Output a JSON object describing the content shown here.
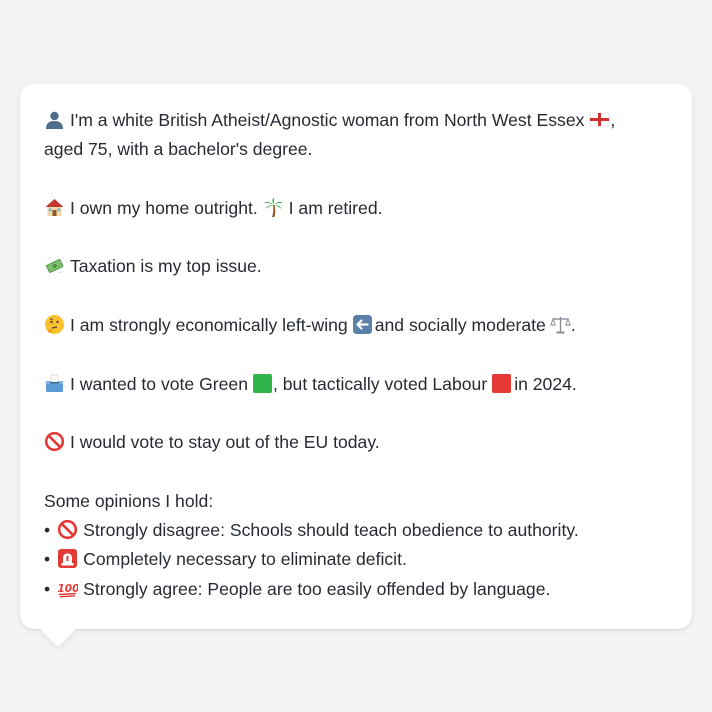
{
  "persona": {
    "intro_line1": "I'm a white British Atheist/Agnostic woman from North West Essex",
    "intro_line1_end": ",",
    "intro_line2": "aged 75, with a bachelor's degree.",
    "home": "I own my home outright.",
    "retired": "I am retired.",
    "top_issue": "Taxation is my top issue.",
    "econ_prefix": "I am strongly economically left-wing",
    "econ_mid": "and socially moderate",
    "econ_end": ".",
    "vote_prefix": "I wanted to vote Green",
    "vote_mid": ", but tactically voted Labour",
    "vote_end": "in 2024.",
    "eu": "I would vote to stay out of the EU today."
  },
  "opinions": {
    "heading": "Some opinions I hold:",
    "bullet": "•",
    "items": [
      {
        "icon": "prohibited-icon",
        "text": "Strongly disagree: Schools should teach obedience to authority."
      },
      {
        "icon": "siren-icon",
        "text": "Completely necessary to eliminate deficit."
      },
      {
        "icon": "hundred-points-icon",
        "text": "Strongly agree: People are too easily offended by language."
      }
    ]
  },
  "colors": {
    "background": "#f3f4f6",
    "card": "#ffffff",
    "text": "#262b33",
    "green": "#2fb54a",
    "labour_red": "#e53935",
    "arrow_blue": "#5a7fa8"
  }
}
